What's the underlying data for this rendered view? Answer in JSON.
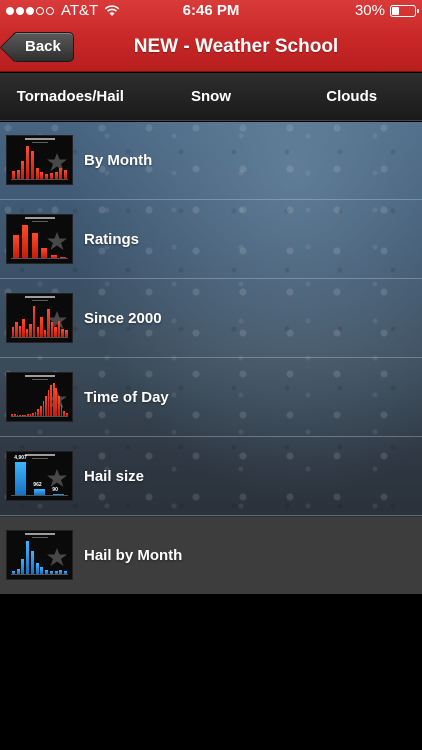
{
  "status_bar": {
    "signal_filled": 3,
    "signal_total": 5,
    "carrier": "AT&T",
    "time": "6:46 PM",
    "battery_text": "30%",
    "battery_level": 0.3
  },
  "nav": {
    "back_label": "Back",
    "title": "NEW - Weather School"
  },
  "tabs": [
    {
      "label": "Tornadoes/Hail"
    },
    {
      "label": "Snow"
    },
    {
      "label": "Clouds"
    }
  ],
  "items": [
    {
      "label": "By Month",
      "color": "red",
      "bars": [
        0.25,
        0.28,
        0.55,
        1.0,
        0.85,
        0.35,
        0.2,
        0.15,
        0.18,
        0.22,
        0.35,
        0.28
      ]
    },
    {
      "label": "Ratings",
      "color": "red",
      "bars": [
        0.7,
        1.0,
        0.75,
        0.3,
        0.08,
        0.02
      ]
    },
    {
      "label": "Since 2000",
      "color": "red",
      "bars": [
        0.3,
        0.45,
        0.35,
        0.55,
        0.25,
        0.4,
        0.95,
        0.3,
        0.6,
        0.2,
        0.85,
        0.45,
        0.3,
        0.5,
        0.25,
        0.2
      ]
    },
    {
      "label": "Time of Day",
      "color": "red",
      "bars": [
        0.05,
        0.05,
        0.04,
        0.04,
        0.03,
        0.04,
        0.05,
        0.06,
        0.08,
        0.12,
        0.2,
        0.3,
        0.45,
        0.62,
        0.8,
        0.95,
        1.0,
        0.85,
        0.6,
        0.35,
        0.15,
        0.08
      ]
    },
    {
      "label": "Hail size",
      "color": "blue",
      "bars": [
        1.0,
        0.18,
        0.04
      ],
      "values": [
        "4,907",
        "962",
        "90"
      ]
    },
    {
      "label": "Hail by Month",
      "color": "blue",
      "bars": [
        0.1,
        0.15,
        0.45,
        1.0,
        0.7,
        0.35,
        0.2,
        0.12,
        0.1,
        0.1,
        0.12,
        0.08
      ]
    }
  ],
  "colors": {
    "header_red": "#c82727",
    "tab_bar": "#222222",
    "bar_red": "#e52b14",
    "bar_blue": "#2a95e8"
  }
}
